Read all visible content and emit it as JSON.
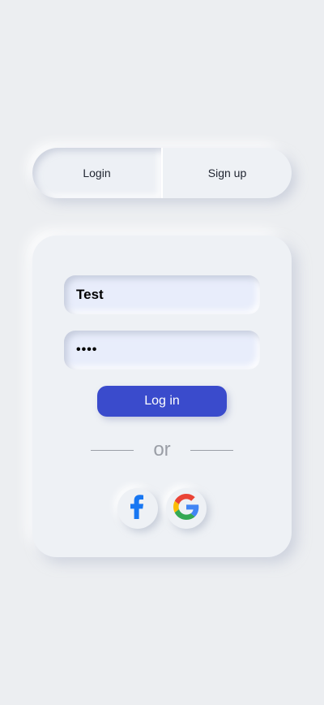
{
  "tabs": {
    "login_label": "Login",
    "signup_label": "Sign up",
    "active": "Login"
  },
  "form": {
    "username_value": "Test",
    "password_value": "••••",
    "login_button_label": "Log in",
    "divider_text": "or"
  },
  "social": {
    "facebook_icon": "facebook-icon",
    "google_icon": "google-icon"
  },
  "colors": {
    "background": "#eceef1",
    "accent": "#3a4bcc",
    "facebook_blue": "#1877f2"
  }
}
